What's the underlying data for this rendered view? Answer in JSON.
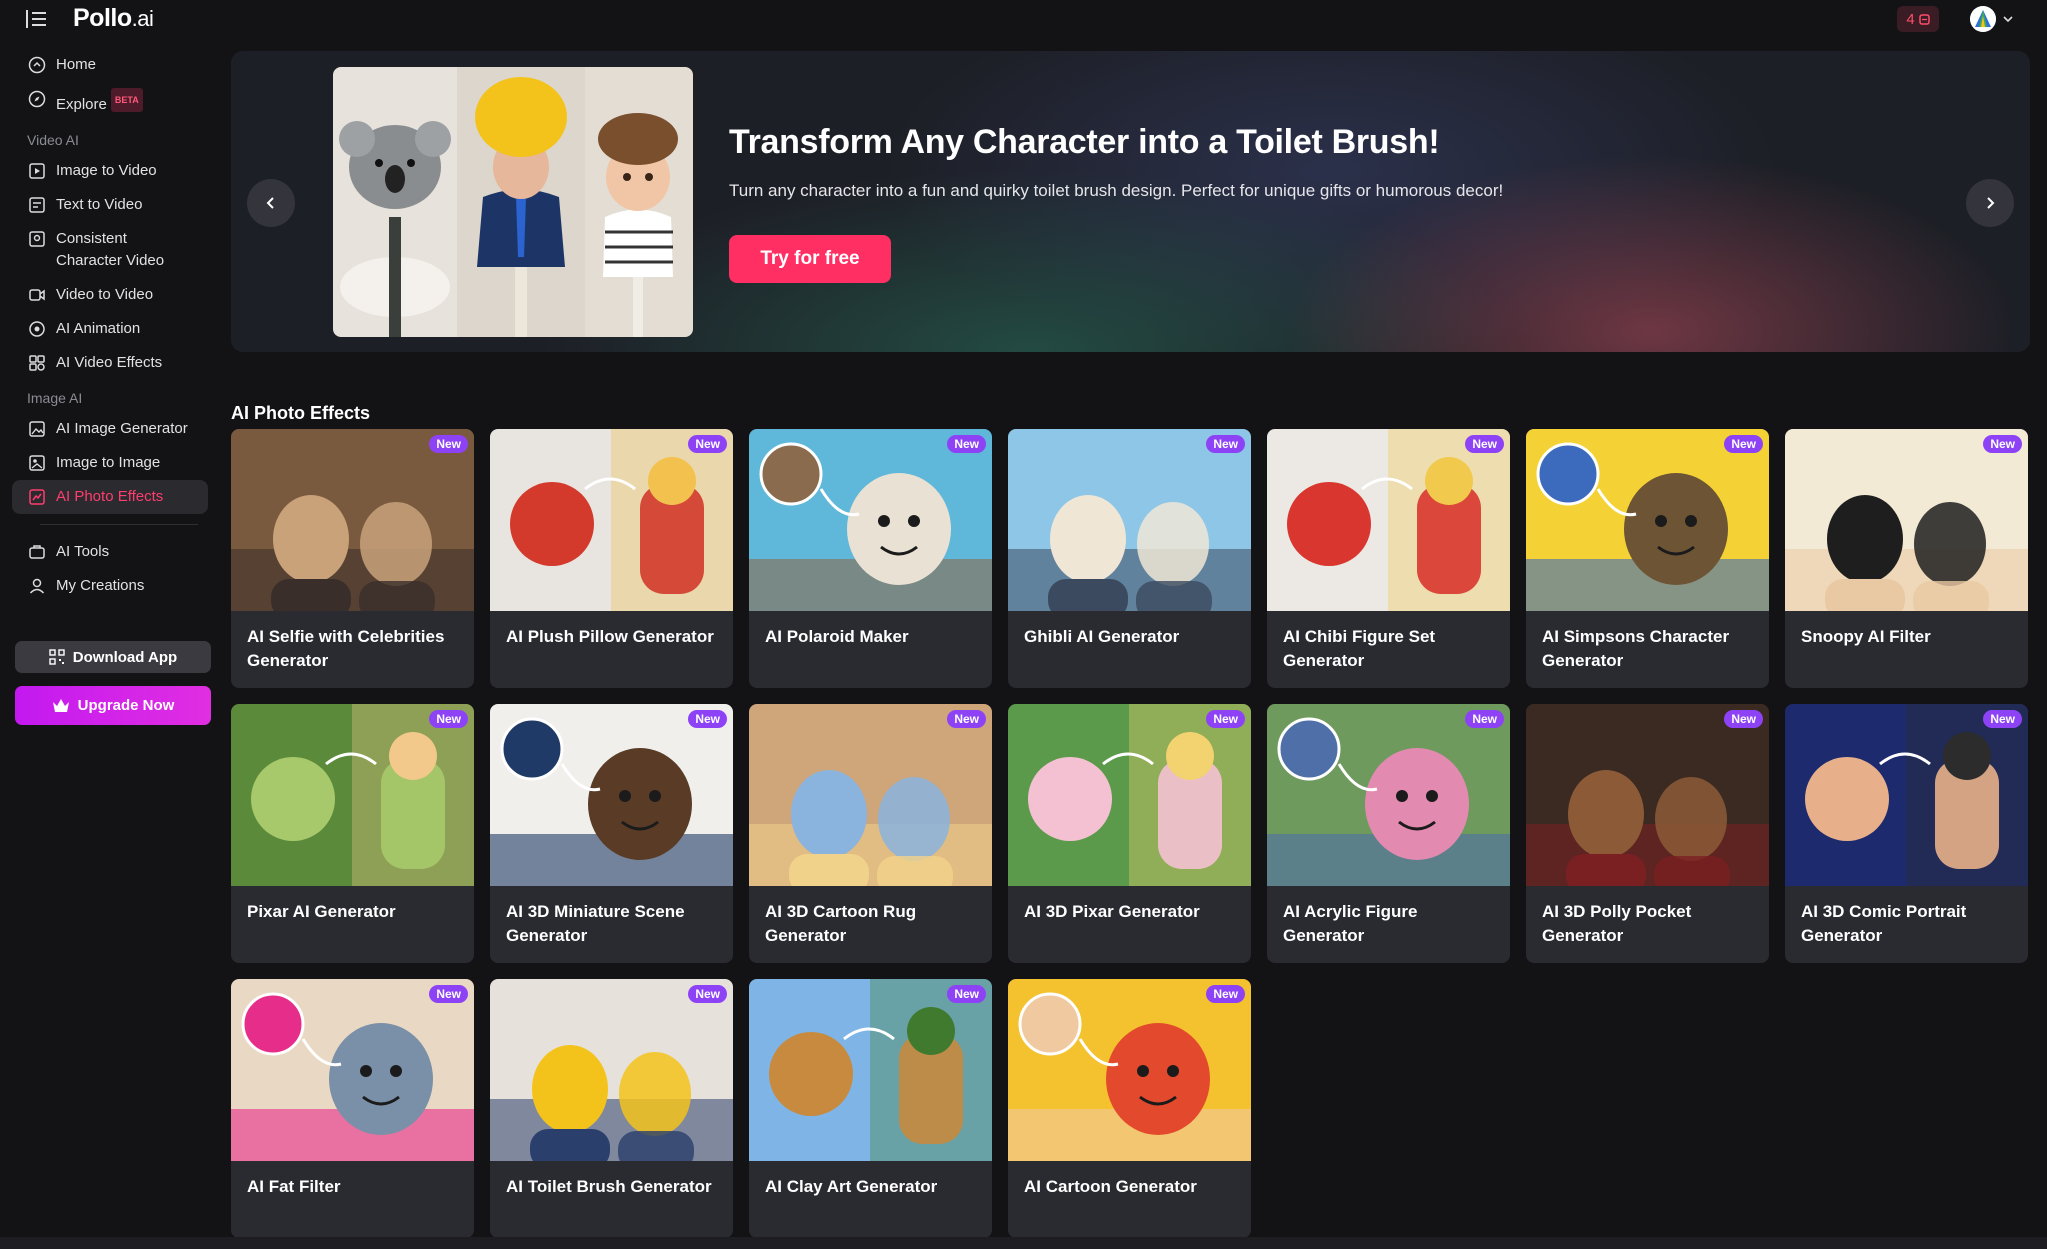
{
  "app": {
    "logo_main": "Pollo",
    "logo_suffix": ".ai",
    "credits": "4"
  },
  "sidebar": {
    "top": [
      {
        "label": "Home",
        "icon": "home-icon"
      },
      {
        "label": "Explore",
        "icon": "compass-icon",
        "badge": "BETA"
      }
    ],
    "sections": [
      {
        "label": "Video AI",
        "items": [
          {
            "label": "Image to Video",
            "icon": "image-video-icon"
          },
          {
            "label": "Text to Video",
            "icon": "text-video-icon"
          },
          {
            "label": "Consistent Character Video",
            "icon": "character-video-icon"
          },
          {
            "label": "Video to Video",
            "icon": "video-video-icon"
          },
          {
            "label": "AI Animation",
            "icon": "animation-icon"
          },
          {
            "label": "AI Video Effects",
            "icon": "effects-icon"
          }
        ]
      },
      {
        "label": "Image AI",
        "items": [
          {
            "label": "AI Image Generator",
            "icon": "image-gen-icon"
          },
          {
            "label": "Image to Image",
            "icon": "image-image-icon"
          },
          {
            "label": "AI Photo Effects",
            "icon": "photo-effects-icon",
            "active": true
          }
        ]
      }
    ],
    "bottom": [
      {
        "label": "AI Tools",
        "icon": "tools-icon"
      },
      {
        "label": "My Creations",
        "icon": "user-icon"
      }
    ],
    "download_label": "Download App",
    "upgrade_label": "Upgrade Now"
  },
  "hero": {
    "title": "Transform Any Character into a Toilet Brush!",
    "subtitle": "Turn any character into a fun and quirky toilet brush design. Perfect for unique gifts or humorous decor!",
    "cta": "Try for free"
  },
  "section_title": "AI Photo Effects",
  "badge_label": "New",
  "cards": [
    {
      "title": "AI Selfie with Celebrities Generator",
      "colors": [
        "#7a5a3e",
        "#c9a27a",
        "#3a2e2a"
      ]
    },
    {
      "title": "AI Plush Pillow Generator",
      "colors": [
        "#e8e4df",
        "#d33a2c",
        "#f2c14e"
      ]
    },
    {
      "title": "AI Polaroid Maker",
      "colors": [
        "#5fb7d9",
        "#e9e1d3",
        "#8a6b4d"
      ]
    },
    {
      "title": "Ghibli AI Generator",
      "colors": [
        "#8ec6e8",
        "#f0e6d6",
        "#3b4a5e"
      ]
    },
    {
      "title": "AI Chibi Figure Set Generator",
      "colors": [
        "#ece9e4",
        "#d8362e",
        "#f1c94c"
      ]
    },
    {
      "title": "AI Simpsons Character Generator",
      "colors": [
        "#f4d235",
        "#6d5434",
        "#3c6bbd"
      ]
    },
    {
      "title": "Snoopy AI Filter",
      "colors": [
        "#f3ead6",
        "#1e1e1e",
        "#e9c9a3"
      ]
    },
    {
      "title": "Pixar AI Generator",
      "colors": [
        "#5a8a3a",
        "#a7c96b",
        "#f2c98a"
      ]
    },
    {
      "title": "AI 3D Miniature Scene Generator",
      "colors": [
        "#f1efec",
        "#5a3b26",
        "#1f3a66"
      ]
    },
    {
      "title": "AI 3D Cartoon Rug Generator",
      "colors": [
        "#cfa57a",
        "#8ab4de",
        "#f1d28a"
      ]
    },
    {
      "title": "AI 3D Pixar Generator",
      "colors": [
        "#5b9a4a",
        "#f4c1d3",
        "#f3d270"
      ]
    },
    {
      "title": "AI Acrylic Figure Generator",
      "colors": [
        "#6f9a5e",
        "#e38ab1",
        "#4f6fa8"
      ]
    },
    {
      "title": "AI 3D Polly Pocket Generator",
      "colors": [
        "#3a2a22",
        "#8c5a36",
        "#7a1f22"
      ]
    },
    {
      "title": "AI 3D Comic Portrait Generator",
      "colors": [
        "#1e2a6e",
        "#e7b08a",
        "#2c2c2c"
      ]
    },
    {
      "title": "AI Fat Filter",
      "colors": [
        "#e9d8c4",
        "#7a8fa8",
        "#e72d8a"
      ]
    },
    {
      "title": "AI Toilet Brush Generator",
      "colors": [
        "#e6e1da",
        "#f3c31c",
        "#2a3f6b"
      ]
    },
    {
      "title": "AI Clay Art Generator",
      "colors": [
        "#7fb5e6",
        "#c78a3e",
        "#3f7a2f"
      ]
    },
    {
      "title": "AI Cartoon Generator",
      "colors": [
        "#f5c22f",
        "#e34a2d",
        "#f1c9a0"
      ]
    }
  ]
}
